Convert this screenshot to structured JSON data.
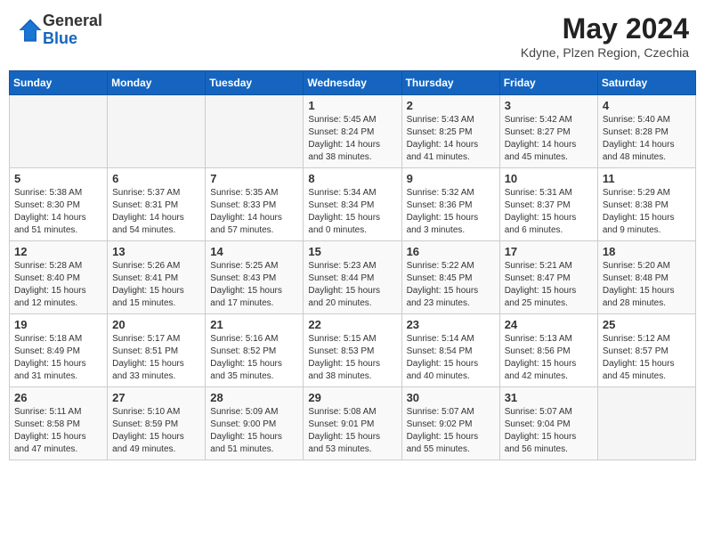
{
  "header": {
    "logo_general": "General",
    "logo_blue": "Blue",
    "month": "May 2024",
    "location": "Kdyne, Plzen Region, Czechia"
  },
  "weekdays": [
    "Sunday",
    "Monday",
    "Tuesday",
    "Wednesday",
    "Thursday",
    "Friday",
    "Saturday"
  ],
  "weeks": [
    [
      {
        "day": "",
        "info": ""
      },
      {
        "day": "",
        "info": ""
      },
      {
        "day": "",
        "info": ""
      },
      {
        "day": "1",
        "info": "Sunrise: 5:45 AM\nSunset: 8:24 PM\nDaylight: 14 hours\nand 38 minutes."
      },
      {
        "day": "2",
        "info": "Sunrise: 5:43 AM\nSunset: 8:25 PM\nDaylight: 14 hours\nand 41 minutes."
      },
      {
        "day": "3",
        "info": "Sunrise: 5:42 AM\nSunset: 8:27 PM\nDaylight: 14 hours\nand 45 minutes."
      },
      {
        "day": "4",
        "info": "Sunrise: 5:40 AM\nSunset: 8:28 PM\nDaylight: 14 hours\nand 48 minutes."
      }
    ],
    [
      {
        "day": "5",
        "info": "Sunrise: 5:38 AM\nSunset: 8:30 PM\nDaylight: 14 hours\nand 51 minutes."
      },
      {
        "day": "6",
        "info": "Sunrise: 5:37 AM\nSunset: 8:31 PM\nDaylight: 14 hours\nand 54 minutes."
      },
      {
        "day": "7",
        "info": "Sunrise: 5:35 AM\nSunset: 8:33 PM\nDaylight: 14 hours\nand 57 minutes."
      },
      {
        "day": "8",
        "info": "Sunrise: 5:34 AM\nSunset: 8:34 PM\nDaylight: 15 hours\nand 0 minutes."
      },
      {
        "day": "9",
        "info": "Sunrise: 5:32 AM\nSunset: 8:36 PM\nDaylight: 15 hours\nand 3 minutes."
      },
      {
        "day": "10",
        "info": "Sunrise: 5:31 AM\nSunset: 8:37 PM\nDaylight: 15 hours\nand 6 minutes."
      },
      {
        "day": "11",
        "info": "Sunrise: 5:29 AM\nSunset: 8:38 PM\nDaylight: 15 hours\nand 9 minutes."
      }
    ],
    [
      {
        "day": "12",
        "info": "Sunrise: 5:28 AM\nSunset: 8:40 PM\nDaylight: 15 hours\nand 12 minutes."
      },
      {
        "day": "13",
        "info": "Sunrise: 5:26 AM\nSunset: 8:41 PM\nDaylight: 15 hours\nand 15 minutes."
      },
      {
        "day": "14",
        "info": "Sunrise: 5:25 AM\nSunset: 8:43 PM\nDaylight: 15 hours\nand 17 minutes."
      },
      {
        "day": "15",
        "info": "Sunrise: 5:23 AM\nSunset: 8:44 PM\nDaylight: 15 hours\nand 20 minutes."
      },
      {
        "day": "16",
        "info": "Sunrise: 5:22 AM\nSunset: 8:45 PM\nDaylight: 15 hours\nand 23 minutes."
      },
      {
        "day": "17",
        "info": "Sunrise: 5:21 AM\nSunset: 8:47 PM\nDaylight: 15 hours\nand 25 minutes."
      },
      {
        "day": "18",
        "info": "Sunrise: 5:20 AM\nSunset: 8:48 PM\nDaylight: 15 hours\nand 28 minutes."
      }
    ],
    [
      {
        "day": "19",
        "info": "Sunrise: 5:18 AM\nSunset: 8:49 PM\nDaylight: 15 hours\nand 31 minutes."
      },
      {
        "day": "20",
        "info": "Sunrise: 5:17 AM\nSunset: 8:51 PM\nDaylight: 15 hours\nand 33 minutes."
      },
      {
        "day": "21",
        "info": "Sunrise: 5:16 AM\nSunset: 8:52 PM\nDaylight: 15 hours\nand 35 minutes."
      },
      {
        "day": "22",
        "info": "Sunrise: 5:15 AM\nSunset: 8:53 PM\nDaylight: 15 hours\nand 38 minutes."
      },
      {
        "day": "23",
        "info": "Sunrise: 5:14 AM\nSunset: 8:54 PM\nDaylight: 15 hours\nand 40 minutes."
      },
      {
        "day": "24",
        "info": "Sunrise: 5:13 AM\nSunset: 8:56 PM\nDaylight: 15 hours\nand 42 minutes."
      },
      {
        "day": "25",
        "info": "Sunrise: 5:12 AM\nSunset: 8:57 PM\nDaylight: 15 hours\nand 45 minutes."
      }
    ],
    [
      {
        "day": "26",
        "info": "Sunrise: 5:11 AM\nSunset: 8:58 PM\nDaylight: 15 hours\nand 47 minutes."
      },
      {
        "day": "27",
        "info": "Sunrise: 5:10 AM\nSunset: 8:59 PM\nDaylight: 15 hours\nand 49 minutes."
      },
      {
        "day": "28",
        "info": "Sunrise: 5:09 AM\nSunset: 9:00 PM\nDaylight: 15 hours\nand 51 minutes."
      },
      {
        "day": "29",
        "info": "Sunrise: 5:08 AM\nSunset: 9:01 PM\nDaylight: 15 hours\nand 53 minutes."
      },
      {
        "day": "30",
        "info": "Sunrise: 5:07 AM\nSunset: 9:02 PM\nDaylight: 15 hours\nand 55 minutes."
      },
      {
        "day": "31",
        "info": "Sunrise: 5:07 AM\nSunset: 9:04 PM\nDaylight: 15 hours\nand 56 minutes."
      },
      {
        "day": "",
        "info": ""
      }
    ]
  ]
}
